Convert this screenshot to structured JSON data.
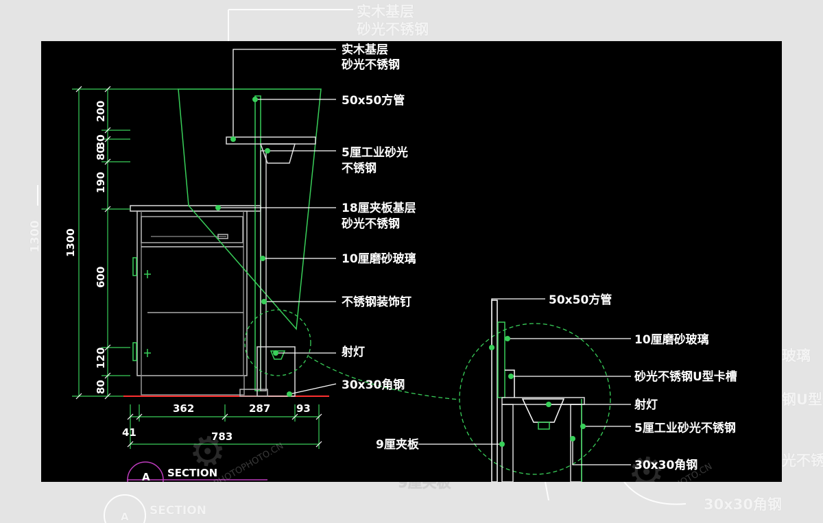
{
  "background_labels": {
    "top_line1": "实木基层",
    "top_line2": "砂光不锈钢",
    "left_dim": "1300",
    "section": "SECTION",
    "marker": "A",
    "right_1": "玻璃",
    "right_2": "钢U型一",
    "right_3": "光不锈",
    "bottom_right": "30x30角钢",
    "bottom_mid": "9厘夹板"
  },
  "drawing": {
    "labels": [
      {
        "line1": "实木基层",
        "line2": "砂光不锈钢"
      },
      {
        "line1": "50x50方管"
      },
      {
        "line1": "5厘工业砂光",
        "line2": "不锈钢"
      },
      {
        "line1": "18厘夹板基层",
        "line2": "砂光不锈钢"
      },
      {
        "line1": "10厘磨砂玻璃"
      },
      {
        "line1": "不锈钢装饰钉"
      },
      {
        "line1": "射灯"
      },
      {
        "line1": "30x30角钢"
      }
    ],
    "vertical_dims": [
      "1300",
      "200",
      "30",
      "80",
      "190",
      "600",
      "120",
      "80"
    ],
    "horizontal_dims": [
      "362",
      "287",
      "93",
      "41",
      "783"
    ],
    "detail_labels": [
      "50x50方管",
      "10厘磨砂玻璃",
      "砂光不锈钢U型卡槽",
      "射灯",
      "5厘工业砂光不锈钢",
      "9厘夹板",
      "30x30角钢"
    ],
    "section_marker": "A",
    "section_title": "SECTION"
  },
  "watermark": "PHOTOPHOTO.CN"
}
